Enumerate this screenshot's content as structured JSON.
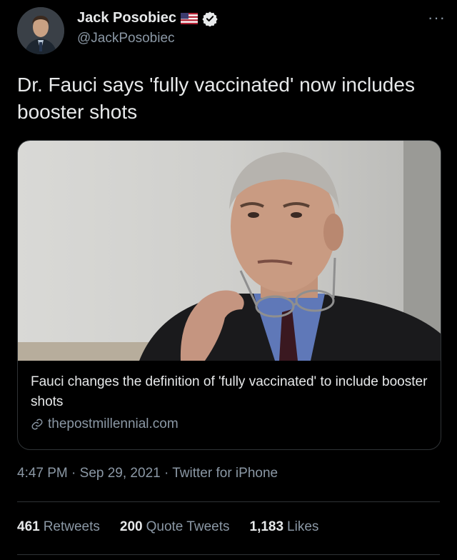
{
  "user": {
    "display_name": "Jack Posobiec",
    "handle": "@JackPosobiec",
    "flag_icon": "us-flag-icon",
    "verified_icon": "verified-badge-icon",
    "avatar": "profile-photo"
  },
  "tweet": {
    "text": "Dr. Fauci says 'fully vaccinated' now includes booster shots"
  },
  "card": {
    "title": "Fauci changes the definition of 'fully vaccinated' to include booster shots",
    "source": "thepostmillennial.com",
    "image": "photo of a man in suit holding glasses"
  },
  "meta": {
    "time": "4:47 PM",
    "separator": " · ",
    "date": "Sep 29, 2021",
    "client": "Twitter for iPhone"
  },
  "stats": {
    "retweets_count": "461",
    "retweets_label": "Retweets",
    "quotes_count": "200",
    "quotes_label": "Quote Tweets",
    "likes_count": "1,183",
    "likes_label": "Likes"
  },
  "colors": {
    "background": "#000000",
    "text": "#e7e9ea",
    "secondary": "#8b98a5",
    "border": "#2f3336",
    "verified": "#ffffff"
  }
}
